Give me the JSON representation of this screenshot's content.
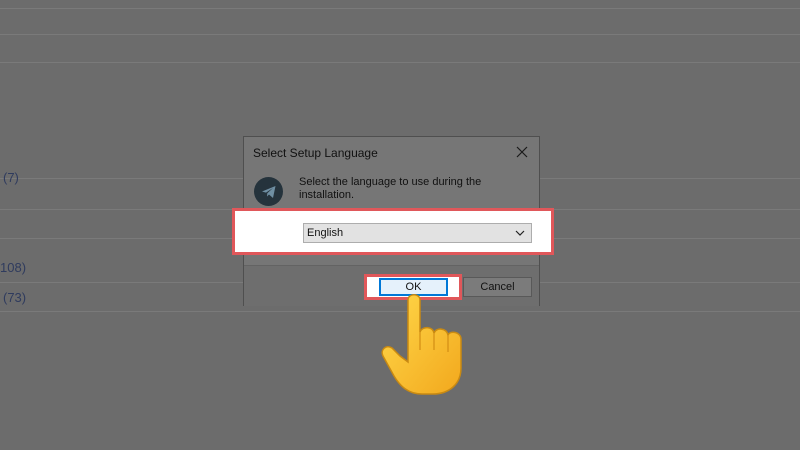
{
  "background": {
    "counts": [
      "(7)",
      "108)",
      "(73)"
    ]
  },
  "dialog": {
    "title": "Select Setup Language",
    "prompt": "Select the language to use during the installation.",
    "language_select": {
      "value": "English"
    },
    "ok_label": "OK",
    "cancel_label": "Cancel"
  },
  "colors": {
    "highlight": "#e0575a",
    "focus_border": "#0078d7",
    "hand": "#f7c531"
  },
  "icons": [
    "close-icon",
    "telegram-logo",
    "chevron-down-icon",
    "pointing-hand-icon"
  ]
}
